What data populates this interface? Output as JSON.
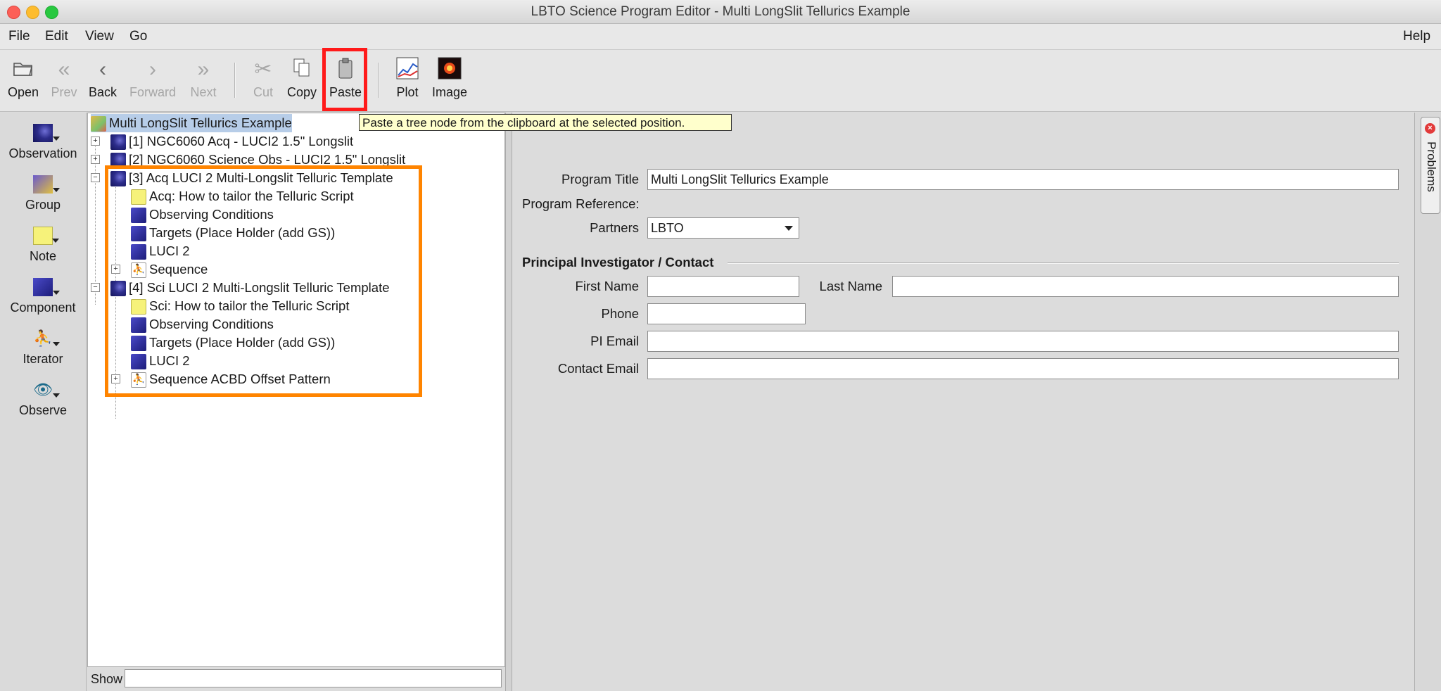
{
  "window": {
    "title": "LBTO Science Program Editor - Multi LongSlit Tellurics Example"
  },
  "menubar": {
    "file": "File",
    "edit": "Edit",
    "view": "View",
    "go": "Go",
    "help": "Help"
  },
  "toolbar": {
    "open": "Open",
    "prev": "Prev",
    "back": "Back",
    "forward": "Forward",
    "next": "Next",
    "cut": "Cut",
    "copy": "Copy",
    "paste": "Paste",
    "plot": "Plot",
    "image": "Image"
  },
  "tooltip": "Paste a tree node from the clipboard at the selected position.",
  "palette": {
    "observation": "Observation",
    "group": "Group",
    "note": "Note",
    "component": "Component",
    "iterator": "Iterator",
    "observe": "Observe"
  },
  "tree": {
    "root": "Multi LongSlit Tellurics Example",
    "obs1": "[1] NGC6060 Acq - LUCI2 1.5\" Longslit",
    "obs2": "[2] NGC6060 Science Obs - LUCI2 1.5\" Longslit",
    "obs3": "[3] Acq LUCI 2 Multi-Longslit Telluric Template",
    "obs3_note": "Acq: How to tailor the Telluric Script",
    "obs3_cond": "Observing Conditions",
    "obs3_targets": "Targets (Place Holder (add GS))",
    "obs3_inst": "LUCI 2",
    "obs3_seq": "Sequence",
    "obs4": "[4] Sci LUCI 2 Multi-Longslit Telluric Template",
    "obs4_note": "Sci: How to tailor the Telluric Script",
    "obs4_cond": "Observing Conditions",
    "obs4_targets": "Targets (Place Holder (add GS))",
    "obs4_inst": "LUCI 2",
    "obs4_seq": "Sequence ACBD Offset Pattern"
  },
  "show": {
    "label": "Show",
    "value": ""
  },
  "form": {
    "program_title_label": "Program Title",
    "program_title_value": "Multi LongSlit Tellurics Example",
    "program_reference_label": "Program Reference:",
    "partners_label": "Partners",
    "partners_value": "LBTO",
    "pi_section": "Principal Investigator / Contact",
    "first_name_label": "First Name",
    "first_name_value": "",
    "last_name_label": "Last Name",
    "last_name_value": "",
    "phone_label": "Phone",
    "phone_value": "",
    "pi_email_label": "PI Email",
    "pi_email_value": "",
    "contact_email_label": "Contact Email",
    "contact_email_value": ""
  },
  "problems_tab": "Problems",
  "colors": {
    "highlight_paste": "#ff1a1a",
    "highlight_tree": "#ff8400",
    "tooltip_bg": "#ffffcc",
    "selection": "#b7cde8"
  }
}
